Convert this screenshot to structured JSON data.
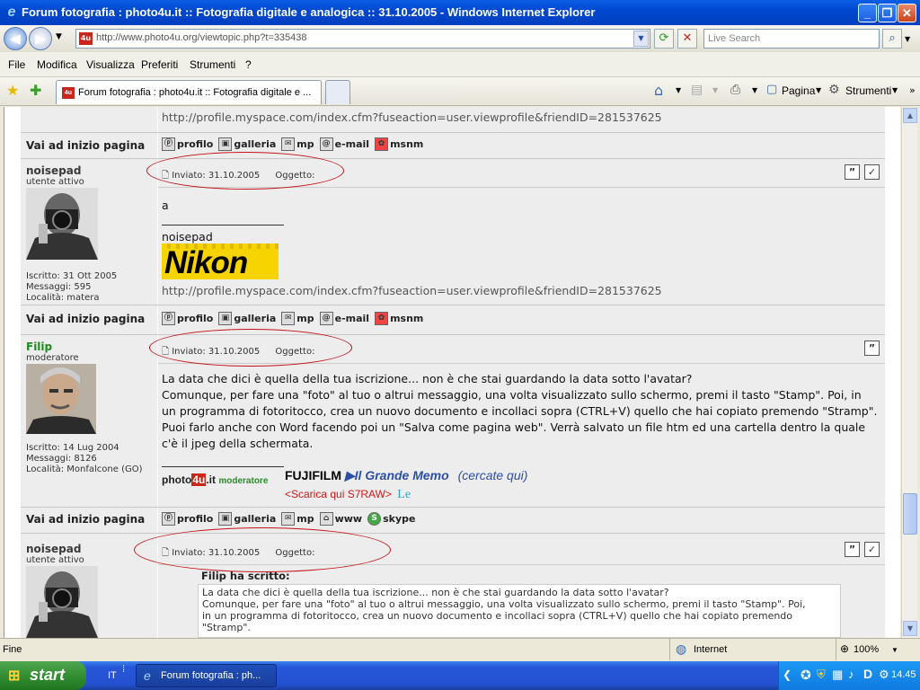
{
  "window": {
    "title": "Forum fotografia : photo4u.it :: Fotografia digitale e analogica :: 31.10.2005 - Windows Internet Explorer",
    "minimize": "_",
    "maximize": "❐",
    "close": "✕"
  },
  "address": {
    "url": "http://www.photo4u.org/viewtopic.php?t=335438",
    "search_placeholder": "Live Search",
    "favicon": "4u"
  },
  "menu": [
    "File",
    "Modifica",
    "Visualizza",
    "Preferiti",
    "Strumenti",
    "?"
  ],
  "tabs": {
    "active": "Forum fotografia : photo4u.it :: Fotografia digitale e ...",
    "page_label": "Pagina",
    "tools_label": "Strumenti"
  },
  "page": {
    "top_url": "http://profile.myspace.com/index.cfm?fuseaction=user.viewprofile&friendID=281537625",
    "back_to_top": "Vai ad inizio pagina",
    "buttons_noisepad": [
      "profilo",
      "galleria",
      "mp",
      "e-mail",
      "msnm"
    ],
    "buttons_filip": [
      "profilo",
      "galleria",
      "mp",
      "www",
      "skype"
    ],
    "posts": [
      {
        "user": "noisepad",
        "rank": "utente attivo",
        "joined": "Iscritto: 31 Ott 2005",
        "messages": "Messaggi: 595",
        "location": "Località: matera",
        "posted": "Inviato: 31.10.2005",
        "subject": "Oggetto:",
        "body": "a",
        "sig_name": "noisepad",
        "sig_logo": "Nikon",
        "sig_url": "http://profile.myspace.com/index.cfm?fuseaction=user.viewprofile&friendID=281537625"
      },
      {
        "user": "Filip",
        "rank": "moderatore",
        "joined": "Iscritto: 14 Lug 2004",
        "messages": "Messaggi: 8126",
        "location": "Località: Monfalcone (GO)",
        "posted": "Inviato: 31.10.2005",
        "subject": "Oggetto:",
        "body_lines": [
          "La data che dici è quella della tua iscrizione... non è che stai guardando la data sotto l'avatar?",
          "Comunque, per fare una \"foto\" al tuo o altrui messaggio, una volta visualizzato sullo schermo, premi il tasto \"Stamp\". Poi, in",
          "un programma di fotoritocco, crea un nuovo documento e incollaci sopra (CTRL+V) quello che hai copiato premendo \"Stramp\".",
          "Puoi farlo anche con Word facendo poi un \"Salva come pagina web\". Verrà salvato un file htm ed una cartella dentro la quale",
          "c'è il jpeg della schermata."
        ],
        "sig_badge_left": "photo",
        "sig_badge_mid": "4u",
        "sig_badge_right": ".it",
        "sig_badge_role": "moderatore",
        "fujifilm": "FUJIFILM",
        "grande_memo": "▶Il  Grande  Memo",
        "cercate": "(cercate  qui)",
        "scarica": "<Scarica qui S7RAW>",
        "le": "Le"
      },
      {
        "user": "noisepad",
        "rank": "utente attivo",
        "posted": "Inviato: 31.10.2005",
        "subject": "Oggetto:",
        "quote_author": "Filip ha scritto:",
        "quote_lines": [
          "La data che dici è quella della tua iscrizione... non è che stai guardando la data sotto l'avatar?",
          "Comunque, per fare una \"foto\" al tuo o altrui messaggio, una volta visualizzato sullo schermo, premi il tasto \"Stamp\". Poi,",
          "in un programma di fotoritocco, crea un nuovo documento e incollaci sopra (CTRL+V) quello che hai copiato premendo",
          "\"Stramp\"."
        ]
      }
    ]
  },
  "status": {
    "text": "Fine",
    "zone": "Internet",
    "zoom": "100%"
  },
  "taskbar": {
    "start": "start",
    "quick": "IT",
    "task": "Forum fotografia : ph...",
    "clock": "14.45"
  }
}
